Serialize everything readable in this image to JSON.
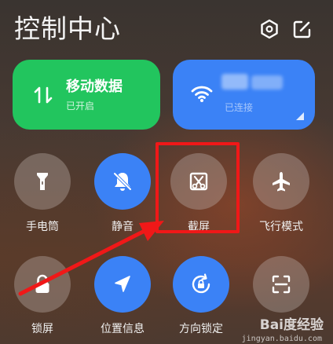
{
  "header": {
    "title": "控制中心",
    "icons": [
      "settings-hex-icon",
      "edit-icon"
    ]
  },
  "tiles": {
    "mobile_data": {
      "title": "移动数据",
      "status": "已开启",
      "icon": "data-arrows-icon",
      "color": "#22c55e"
    },
    "wifi": {
      "status": "已连接",
      "icon": "wifi-icon",
      "color": "#3b82f6"
    }
  },
  "toggles": [
    {
      "label": "手电筒",
      "icon": "flashlight-icon",
      "state": "off"
    },
    {
      "label": "静音",
      "icon": "bell-mute-icon",
      "state": "on"
    },
    {
      "label": "截屏",
      "icon": "screenshot-scissors-icon",
      "state": "off"
    },
    {
      "label": "飞行模式",
      "icon": "airplane-icon",
      "state": "off"
    },
    {
      "label": "锁屏",
      "icon": "lock-icon",
      "state": "off"
    },
    {
      "label": "位置信息",
      "icon": "location-arrow-icon",
      "state": "on"
    },
    {
      "label": "方向锁定",
      "icon": "rotation-lock-icon",
      "state": "on"
    },
    {
      "label": "",
      "icon": "scan-icon",
      "state": "off"
    }
  ],
  "annotation": {
    "color": "#f01818",
    "target": "截屏"
  },
  "watermark": {
    "brand": "Bai度经验",
    "url": "jingyan.baidu.com"
  }
}
